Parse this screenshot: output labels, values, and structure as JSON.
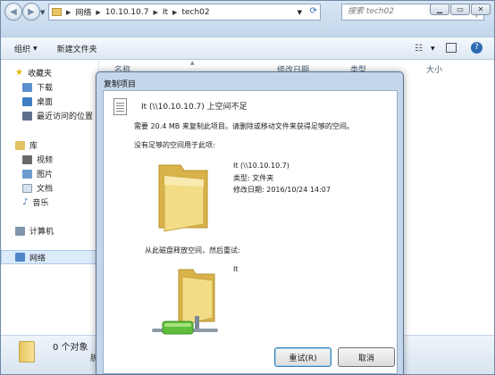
{
  "explorer": {
    "breadcrumb": [
      "网络",
      "10.10.10.7",
      "It",
      "tech02"
    ],
    "search_placeholder": "搜索 tech02",
    "toolbar": {
      "organize": "组织",
      "new_folder": "新建文件夹"
    },
    "columns": {
      "name": "名称",
      "date": "修改日期",
      "type": "类型",
      "size": "大小"
    },
    "sidebar": {
      "favorites": "收藏夹",
      "downloads": "下载",
      "desktop": "桌面",
      "recent": "最近访问的位置",
      "libraries": "库",
      "videos": "视频",
      "pictures": "图片",
      "documents": "文档",
      "music": "音乐",
      "computer": "计算机",
      "network": "网络"
    },
    "status": {
      "count": "0 个对象",
      "sub": "脱"
    }
  },
  "dialog": {
    "title": "复制项目",
    "heading": "It (\\\\10.10.10.7) 上空间不足",
    "need_text": "需要 20.4 MB 来复制此项目。请删除或移动文件来获得足够的空间。",
    "not_enough_label": "没有足够的空间用于此项:",
    "item": {
      "name": "It (\\\\10.10.10.7)",
      "type_line": "类型: 文件夹",
      "modified_line": "修改日期: 2016/10/24 14:07"
    },
    "free_label": "从此磁盘释放空间，然后重试:",
    "drive_name": "It",
    "buttons": {
      "retry": "重试(R)",
      "cancel": "取消"
    }
  },
  "colors": {
    "accent": "#3c7fb1",
    "folder": "#f2d56b"
  }
}
